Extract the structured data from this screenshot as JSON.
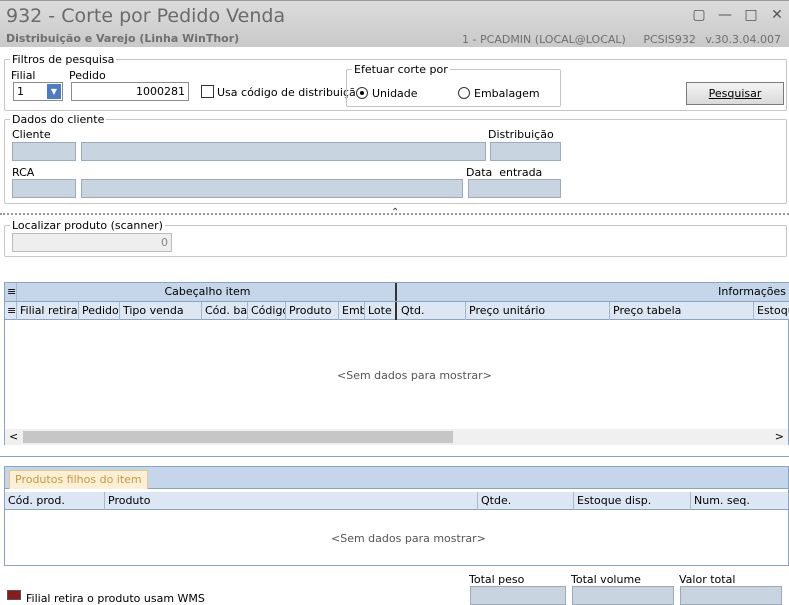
{
  "window": {
    "title": "932 - Corte por Pedido Venda",
    "subtitle": "Distribuição e Varejo (Linha WinThor)",
    "user": "1 - PCADMIN (LOCAL@LOCAL)",
    "program": "PCSIS932",
    "version": "v.30.3.04.007"
  },
  "filtros": {
    "legend": "Filtros de pesquisa",
    "filial_label": "Filial",
    "filial_value": "1",
    "pedido_label": "Pedido",
    "pedido_value": "1000281",
    "usa_codigo_label": "Usa código de distribuição",
    "corte_legend": "Efetuar corte por",
    "unidade_label": "Unidade",
    "embalagem_label": "Embalagem",
    "selected": "Unidade",
    "pesquisar_label": "Pesquisar"
  },
  "cliente": {
    "legend": "Dados do cliente",
    "cliente_label": "Cliente",
    "distribuicao_label": "Distribuição",
    "rca_label": "RCA",
    "data_entrada_label": "Data  entrada"
  },
  "localizar": {
    "label": "Localizar produto (scanner)",
    "value": "0"
  },
  "grid1": {
    "band1": "Cabeçalho item",
    "band2": "Informações",
    "cols": [
      "Filial retira",
      "Pedido",
      "Tipo venda",
      "Cód. bar",
      "Código",
      "Produto",
      "Emba",
      "Lote",
      "Qtd.",
      "Preço unitário",
      "Preço tabela",
      "Estoque"
    ],
    "empty": "<Sem dados para mostrar>"
  },
  "grid2": {
    "tab": "Produtos filhos do item",
    "cols": [
      "Cód. prod.",
      "Produto",
      "Qtde.",
      "Estoque disp.",
      "Num. seq."
    ],
    "empty": "<Sem dados para mostrar>"
  },
  "footer": {
    "legend_text": "Filial retira o produto usam WMS",
    "total_peso": "Total peso",
    "total_volume": "Total volume",
    "valor_total": "Valor total",
    "legend_color": "#8b1a1a"
  }
}
